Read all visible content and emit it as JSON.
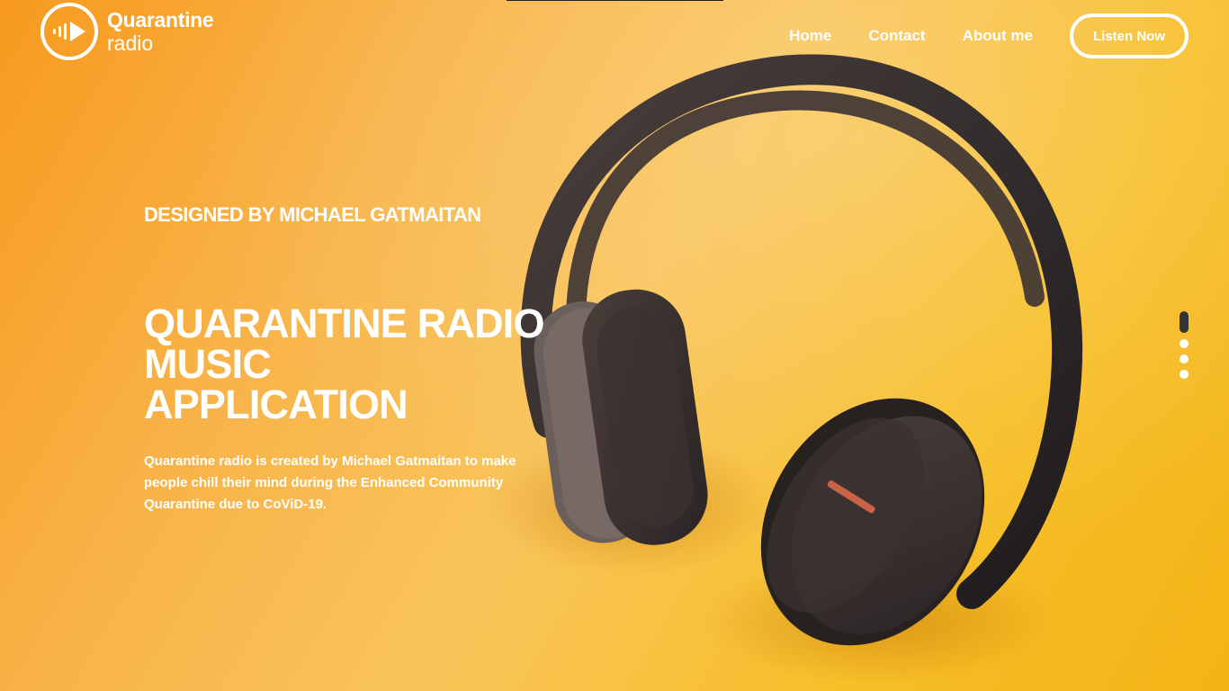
{
  "brand": {
    "name": "Quarantine",
    "subname": "radio",
    "accent": "#f7a823",
    "logo_icon": "play-wave-icon"
  },
  "nav": {
    "items": [
      {
        "label": "Home"
      },
      {
        "label": "Contact"
      },
      {
        "label": "About me"
      }
    ],
    "cta_label": "Listen Now"
  },
  "hero": {
    "eyebrow": "DESIGNED BY MICHAEL GATMAITAN",
    "headline_lines": [
      "QUARANTINE RADIO",
      "MUSIC",
      "APPLICATION"
    ],
    "description": "Quarantine radio is created by Michael Gatmaitan to make people chill their mind during the Enhanced Community Quarantine due to CoViD-19.",
    "image_icon": "headphones-icon"
  },
  "slider": {
    "total": 4,
    "active_index": 0
  }
}
